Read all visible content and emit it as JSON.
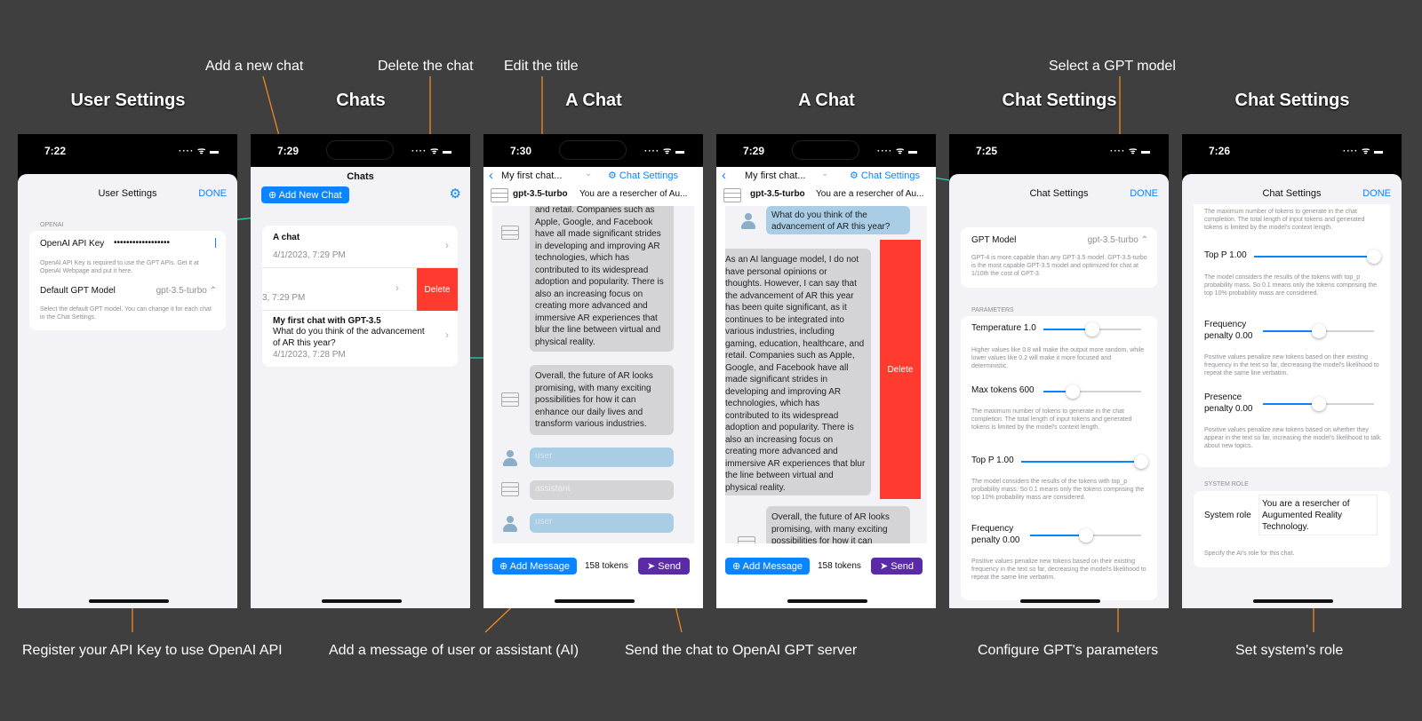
{
  "captions": {
    "add_new_chat": "Add a new chat",
    "delete_chat": "Delete the chat",
    "edit_title": "Edit the title",
    "select_model": "Select a GPT model",
    "register_key": "Register your API Key to use OpenAI API",
    "add_message": "Add a message of user or assistant (AI)",
    "send_chat": "Send the chat to OpenAI GPT server",
    "configure_params": "Configure GPT's parameters",
    "set_role": "Set system's role"
  },
  "titles": [
    "User Settings",
    "Chats",
    "A Chat",
    "A Chat",
    "Chat Settings",
    "Chat Settings"
  ],
  "status_times": [
    "7:22",
    "7:29",
    "7:30",
    "7:29",
    "7:25",
    "7:26"
  ],
  "status_icons": "···· ᯤ ▬",
  "user_settings": {
    "nav_title": "User Settings",
    "done": "DONE",
    "section": "OPENAI",
    "api_key_label": "OpenAI API Key",
    "api_key_value": "••••••••••••••••••",
    "api_key_help": "OpenAI API Key is required to use the GPT APIs. Get it at OpenAI Webpage and put it here.",
    "default_model_label": "Default GPT Model",
    "default_model_value": "gpt-3.5-turbo ⌃",
    "default_model_help": "Select the default GPT model. You can change it for each chat in the Chat Settings."
  },
  "chats": {
    "nav_title": "Chats",
    "add_button": "Add New Chat",
    "items": [
      {
        "title": "A chat",
        "date": "4/1/2023, 7:29 PM"
      },
      {
        "title": "",
        "date": "3, 7:29 PM"
      },
      {
        "title": "My first chat with GPT-3.5",
        "subtitle": "What do you think of the advancement of AR this year?",
        "date": "4/1/2023, 7:28 PM"
      }
    ],
    "delete_label": "Delete"
  },
  "chat1": {
    "title": "My first chat...",
    "settings_link": "Chat Settings",
    "model": "gpt-3.5-turbo",
    "system_preview": "You are a resercher of Au...",
    "msg1": "and retail. Companies such as Apple, Google, and Facebook have all made significant strides in developing and improving AR technologies, which has contributed to its widespread adoption and popularity. There is also an increasing focus on creating more advanced and immersive AR experiences that blur the line between virtual and physical reality.",
    "msg2": "Overall, the future of AR looks promising, with many exciting possibilities for how it can enhance our daily lives and transform various industries.",
    "ph_user": "user",
    "ph_assistant": "assistant",
    "add_message": "Add Message",
    "tokens": "158 tokens",
    "send": "Send"
  },
  "chat2": {
    "title": "My first chat...",
    "settings_link": "Chat Settings",
    "model": "gpt-3.5-turbo",
    "system_preview": "You are a resercher of Au...",
    "question": "What do you think of the advancement of AR this year?",
    "answer": "As an AI language model, I do not have personal opinions or thoughts. However, I can say that the advancement of AR this year has been quite significant, as it continues to be integrated into various industries, including gaming, education, healthcare, and retail. Companies such as Apple, Google, and Facebook have all made significant strides in developing and improving AR technologies, which has contributed to its widespread adoption and popularity. There is also an increasing focus on creating more advanced and immersive AR experiences that blur the line between virtual and physical reality.",
    "msg2": "Overall, the future of AR looks promising, with many exciting possibilities for how it can enhance our daily lives and transform various industries.",
    "delete_label": "Delete",
    "add_message": "Add Message",
    "tokens": "158 tokens",
    "send": "Send"
  },
  "settings1": {
    "nav_title": "Chat Settings",
    "done": "DONE",
    "model_label": "GPT Model",
    "model_value": "gpt-3.5-turbo ⌃",
    "model_help": "GPT-4 is more capable than any GPT-3.5 model. GPT-3.5-turbo is the most capable GPT-3.5 model and optimized for chat at 1/10th the cost of GPT-3.",
    "params_header": "PARAMETERS",
    "temperature_label": "Temperature 1.0",
    "temperature_value": 0.5,
    "temperature_help": "Higher values like 0.8 will make the output more random, while lower values like 0.2 will make it more focused and deterministic.",
    "max_tokens_label": "Max tokens 600",
    "max_tokens_value": 0.3,
    "max_tokens_help": "The maximum number of tokens to generate in the chat completion. The total length of input tokens and generated tokens is limited by the model's context length.",
    "top_p_label": "Top P 1.00",
    "top_p_value": 1.0,
    "top_p_help": "The model considers the results of the tokens with top_p probability mass. So 0.1 means only the tokens comprising the top 10% probability mass are considered.",
    "freq_label": "Frequency penalty 0.00",
    "freq_value": 0.5,
    "freq_help": "Positive values penalize new tokens based on their existing frequency in the text so far, decreasing the model's likelihood to repeat the same line verbatim."
  },
  "settings2": {
    "nav_title": "Chat Settings",
    "done": "DONE",
    "max_tokens_help": "The maximum number of tokens to generate in the chat completion. The total length of input tokens and generated tokens is limited by the model's context length.",
    "top_p_label": "Top P 1.00",
    "top_p_value": 1.0,
    "top_p_help": "The model considers the results of the tokens with top_p probability mass. So 0.1 means only the tokens comprising the top 10% probability mass are considered.",
    "freq_label": "Frequency penalty 0.00",
    "freq_value": 0.5,
    "freq_help": "Positive values penalize new tokens based on their existing frequency in the text so far, decreasing the model's likelihood to repeat the same line verbatim.",
    "presence_label": "Presence penalty 0.00",
    "presence_value": 0.5,
    "presence_help": "Positive values penalize new tokens based on whether they appear in the text so far, increasing the model's likelihood to talk about new topics.",
    "system_header": "SYSTEM ROLE",
    "system_label": "System role",
    "system_value": "You are a resercher of Augumented Reality Technology.",
    "system_help": "Specify the AI's role for this chat."
  },
  "colors": {
    "background": "#3f3f3f",
    "accent": "#0a84ff",
    "send": "#5b2aa6",
    "delete": "#ff3b30",
    "annotation": "#f08a1c",
    "arrow": "#2ad1b8"
  }
}
